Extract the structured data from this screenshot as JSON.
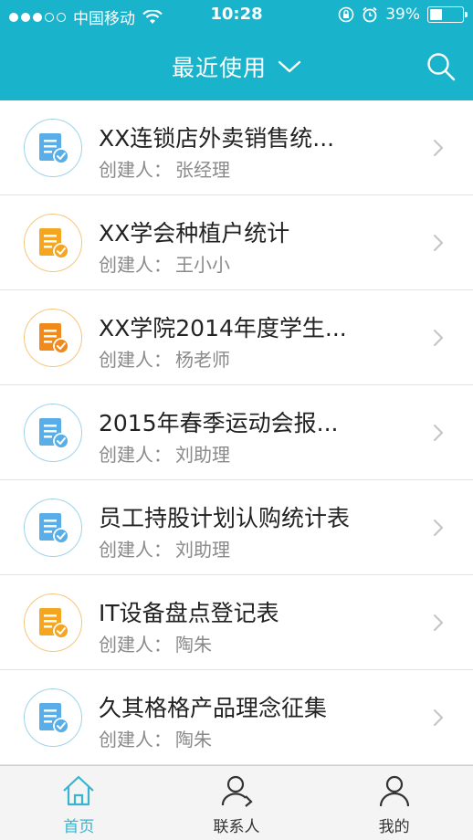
{
  "status_bar": {
    "carrier": "中国移动",
    "time": "10:28",
    "battery": "39%",
    "battery_level": 0.39
  },
  "header": {
    "title": "最近使用",
    "title_icon": "chevron-down-icon",
    "search_icon": "search-icon"
  },
  "list": {
    "creator_label": "创建人：",
    "items": [
      {
        "title": "XX连锁店外卖销售统...",
        "creator": "张经理",
        "icon_color": "#5aaee8"
      },
      {
        "title": "XX学会种植户统计",
        "creator": "王小小",
        "icon_color": "#f4a623"
      },
      {
        "title": "XX学院2014年度学生...",
        "creator": "杨老师",
        "icon_color": "#f08a1c"
      },
      {
        "title": "2015年春季运动会报...",
        "creator": "刘助理",
        "icon_color": "#5aaee8"
      },
      {
        "title": "员工持股计划认购统计表",
        "creator": "刘助理",
        "icon_color": "#5aaee8"
      },
      {
        "title": "IT设备盘点登记表",
        "creator": "陶朱",
        "icon_color": "#f4a623"
      },
      {
        "title": "久其格格产品理念征集",
        "creator": "陶朱",
        "icon_color": "#5aaee8"
      }
    ]
  },
  "tabbar": {
    "tabs": [
      {
        "label": "首页",
        "icon": "home-icon",
        "active": true
      },
      {
        "label": "联系人",
        "icon": "contacts-icon",
        "active": false
      },
      {
        "label": "我的",
        "icon": "profile-icon",
        "active": false
      }
    ],
    "active_color": "#38b4cf"
  },
  "colors": {
    "header_bg": "#1ab3cc",
    "blue_icon": "#5aaee8",
    "orange_icon": "#f4a623"
  }
}
